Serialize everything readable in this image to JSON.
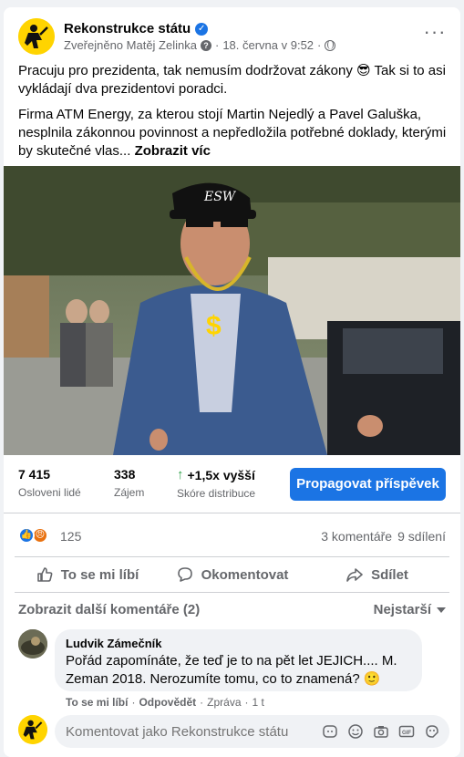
{
  "post": {
    "page_name": "Rekonstrukce státu",
    "published_by": "Zveřejněno Matěj Zelinka",
    "separator": "·",
    "timestamp": "18. června v 9:52",
    "text_line1": "Pracuju pro prezidenta, tak nemusím dodržovat zákony 😎 Tak si to asi vykládají dva prezidentovi poradci.",
    "text_line2": "Firma ATM Energy, za kterou stojí Martin Nejedlý a Pavel Galuška, nesplnila zákonnou povinnost a nepředložila potřebné doklady, kterými by skutečné vlas...",
    "see_more": "Zobrazit víc",
    "photo_caption_cap_text": "ESW",
    "photo_dollar": "$"
  },
  "insights": {
    "reached_value": "7 415",
    "reached_label": "Osloveni lidé",
    "engagement_value": "338",
    "engagement_label": "Zájem",
    "distribution_value": "+1,5x vyšší",
    "distribution_label": "Skóre distribuce",
    "promote_label": "Propagovat příspěvek"
  },
  "reactions": {
    "count": "125",
    "comments": "3 komentáře",
    "shares": "9 sdílení"
  },
  "actions": {
    "like": "To se mi líbí",
    "comment": "Okomentovat",
    "share": "Sdílet"
  },
  "comments": {
    "more_label": "Zobrazit další komentáře (2)",
    "sort_label": "Nejstarší",
    "items": [
      {
        "author": "Ludvik Zámečník",
        "text": "Pořád zapomínáte, že teď je to na pět let JEJICH.... M. Zeman 2018. Nerozumíte tomu, co to znamená? 🙂",
        "like_action": "To se mi líbí",
        "reply_action": "Odpovědět",
        "message_action": "Zpráva",
        "age": "1 t"
      }
    ]
  },
  "composer": {
    "placeholder": "Komentovat jako Rekonstrukce státu"
  },
  "colors": {
    "accent": "#1b74e4",
    "brand_yellow": "#ffd400",
    "positive": "#31a24c",
    "secondary_text": "#65676b"
  }
}
